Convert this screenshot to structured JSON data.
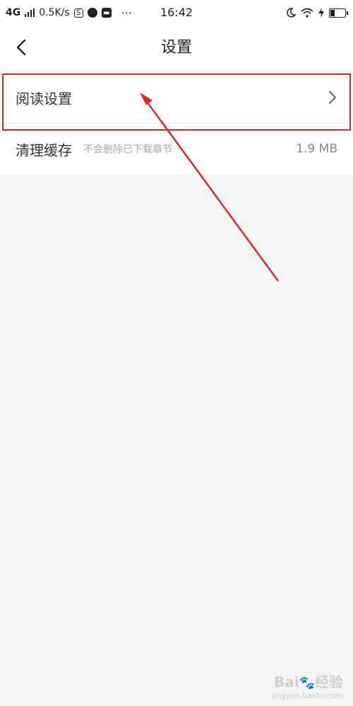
{
  "status_bar": {
    "network": "4G",
    "speed": "0.5K/s",
    "notif_s": "S",
    "dots": "···",
    "time": "16:42"
  },
  "header": {
    "title": "设置"
  },
  "settings": [
    {
      "label": "阅读设置"
    },
    {
      "label": "清理缓存",
      "sublabel": "不会删除已下载章节",
      "value": "1.9 MB"
    }
  ],
  "watermark": {
    "brand": "Bai",
    "text": "经验",
    "url": "jingyan.baidu.com"
  },
  "colors": {
    "annotation": "#d22b2b",
    "background": "#f5f5f5"
  }
}
